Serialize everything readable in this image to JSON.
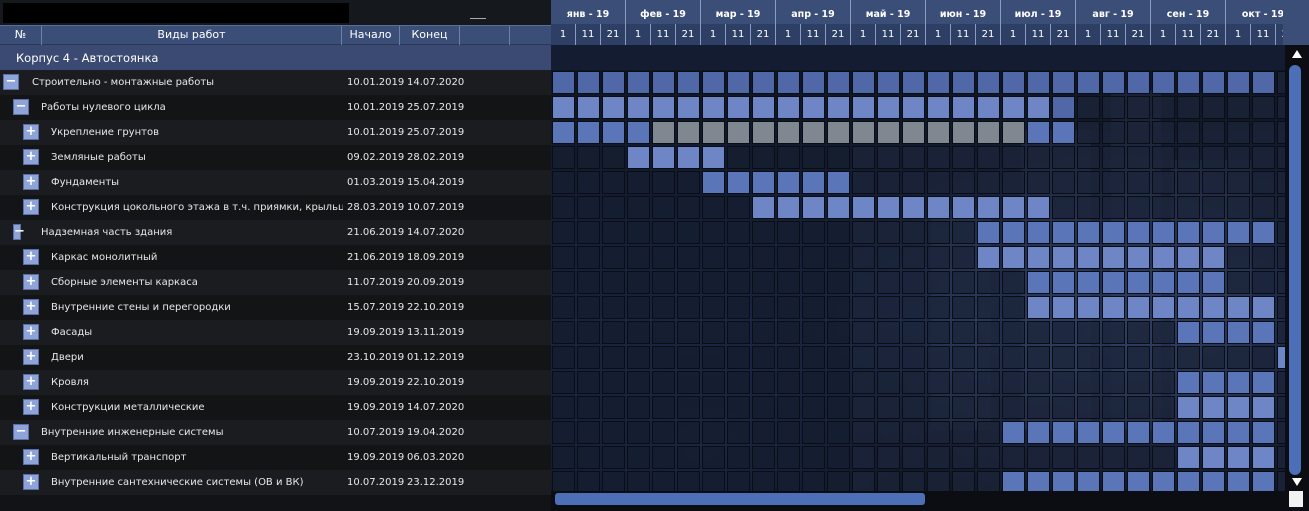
{
  "columns": {
    "num": "№",
    "work": "Виды работ",
    "start": "Начало",
    "end": "Конец"
  },
  "group_title": "Корпус 4 - Автостоянка",
  "months": [
    "янв - 19",
    "фев - 19",
    "мар - 19",
    "апр - 19",
    "май - 19",
    "июн - 19",
    "июл - 19",
    "авг - 19",
    "сен - 19",
    "окт - 19"
  ],
  "days": [
    "1",
    "11",
    "21"
  ],
  "rows": [
    {
      "name": "Строительно - монтажные работы",
      "start": "10.01.2019",
      "end": "14.07.2020",
      "level": 0,
      "toggle": "−",
      "bar": [
        0,
        28
      ]
    },
    {
      "name": "Работы нулевого цикла",
      "start": "10.01.2019",
      "end": "25.07.2019",
      "level": 1,
      "toggle": "−",
      "bar": [
        0,
        20
      ]
    },
    {
      "name": "Укрепление грунтов",
      "start": "10.01.2019",
      "end": "25.07.2019",
      "level": 2,
      "toggle": "+",
      "bar": [
        0,
        20
      ],
      "grey": [
        4,
        18
      ]
    },
    {
      "name": "Земляные работы",
      "start": "09.02.2019",
      "end": "28.02.2019",
      "level": 2,
      "toggle": "+",
      "bar": [
        3,
        6
      ]
    },
    {
      "name": "Фундаменты",
      "start": "01.03.2019",
      "end": "15.04.2019",
      "level": 2,
      "toggle": "+",
      "bar": [
        6,
        11
      ]
    },
    {
      "name": "Конструкция цокольного этажа в т.ч. приямки, крыльца, пандусы",
      "start": "28.03.2019",
      "end": "10.07.2019",
      "level": 2,
      "toggle": "+",
      "bar": [
        8,
        19
      ]
    },
    {
      "name": "Надземная часть здания",
      "start": "21.06.2019",
      "end": "14.07.2020",
      "level": 1,
      "toggle": "−",
      "bar": [
        17,
        28
      ]
    },
    {
      "name": "Каркас монолитный",
      "start": "21.06.2019",
      "end": "18.09.2019",
      "level": 2,
      "toggle": "+",
      "bar": [
        17,
        26
      ]
    },
    {
      "name": "Сборные элементы каркаса",
      "start": "11.07.2019",
      "end": "20.09.2019",
      "level": 2,
      "toggle": "+",
      "bar": [
        19,
        26
      ]
    },
    {
      "name": "Внутренние стены и перегородки",
      "start": "15.07.2019",
      "end": "22.10.2019",
      "level": 2,
      "toggle": "+",
      "bar": [
        19,
        28
      ]
    },
    {
      "name": "Фасады",
      "start": "19.09.2019",
      "end": "13.11.2019",
      "level": 2,
      "toggle": "+",
      "bar": [
        25,
        28
      ]
    },
    {
      "name": "Двери",
      "start": "23.10.2019",
      "end": "01.12.2019",
      "level": 2,
      "toggle": "+",
      "bar": [
        29,
        29
      ]
    },
    {
      "name": "Кровля",
      "start": "19.09.2019",
      "end": "22.10.2019",
      "level": 2,
      "toggle": "+",
      "bar": [
        25,
        28
      ]
    },
    {
      "name": "Конструкции металлические",
      "start": "19.09.2019",
      "end": "14.07.2020",
      "level": 2,
      "toggle": "+",
      "bar": [
        25,
        28
      ]
    },
    {
      "name": "Внутренние инженерные системы",
      "start": "10.07.2019",
      "end": "19.04.2020",
      "level": 1,
      "toggle": "−",
      "bar": [
        18,
        28
      ]
    },
    {
      "name": "Вертикальный транспорт",
      "start": "19.09.2019",
      "end": "06.03.2020",
      "level": 2,
      "toggle": "+",
      "bar": [
        25,
        28
      ]
    },
    {
      "name": "Внутренние сантехнические системы (ОВ и ВК)",
      "start": "10.07.2019",
      "end": "23.12.2019",
      "level": 2,
      "toggle": "+",
      "bar": [
        18,
        28
      ]
    }
  ],
  "colors": {
    "bar": "#5b75b9",
    "bar_light": "#6e86c6",
    "grey": "#7f8890",
    "empty": "#1b2438",
    "header": "#3b4e78",
    "group": "#3b4a72",
    "scroll": "#4c6fb8"
  }
}
